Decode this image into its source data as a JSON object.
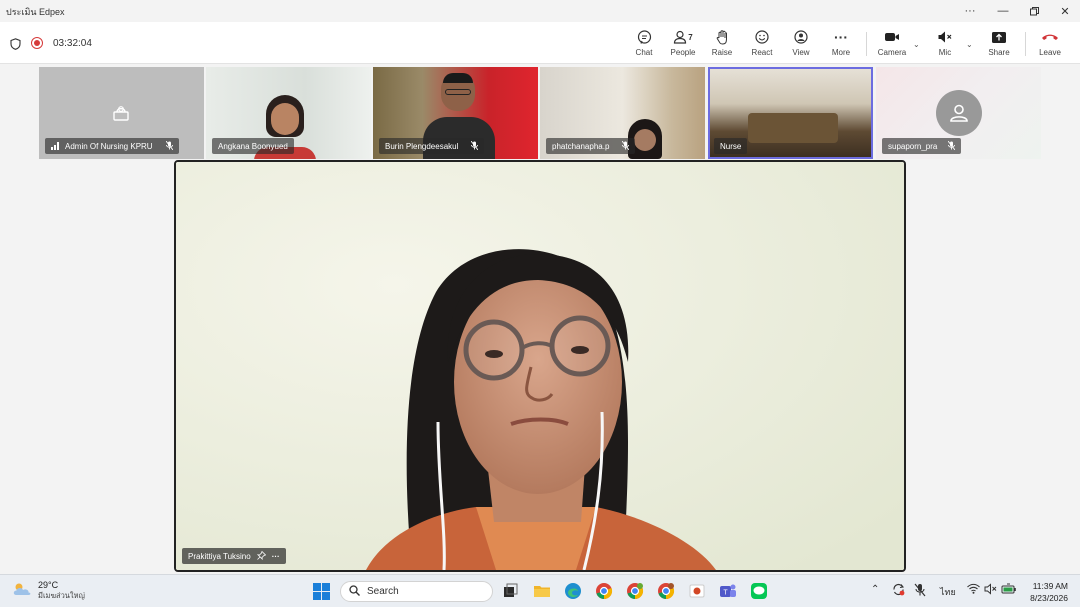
{
  "window": {
    "title": "ประเมิน Edpex"
  },
  "toolbar": {
    "timer": "03:32:04",
    "chat_label": "Chat",
    "people_label": "People",
    "people_count": "7",
    "raise_label": "Raise",
    "react_label": "React",
    "view_label": "View",
    "more_label": "More",
    "camera_label": "Camera",
    "mic_label": "Mic",
    "share_label": "Share",
    "leave_label": "Leave",
    "leave_color": "#d13438"
  },
  "participants": [
    {
      "name": "Admin Of Nursing KPRU",
      "muted": true
    },
    {
      "name": "Angkana Boonyued",
      "muted": false
    },
    {
      "name": "Burin Plengdeesakul",
      "muted": true
    },
    {
      "name": "phatchanapha.p",
      "muted": true
    },
    {
      "name": "Nurse",
      "muted": false,
      "active": true
    },
    {
      "name": "supaporn_pra",
      "muted": true
    }
  ],
  "main_speaker": {
    "name": "Prakittiya Tuksino"
  },
  "taskbar": {
    "temperature": "29°C",
    "weather_desc": "มีเมฆส่วนใหญ่",
    "search_label": "Search",
    "language": "ไทย",
    "time": "11:39 AM",
    "date": "8/23/2026"
  },
  "colors": {
    "accent": "#6c6ce0",
    "record": "#d63a3a"
  }
}
